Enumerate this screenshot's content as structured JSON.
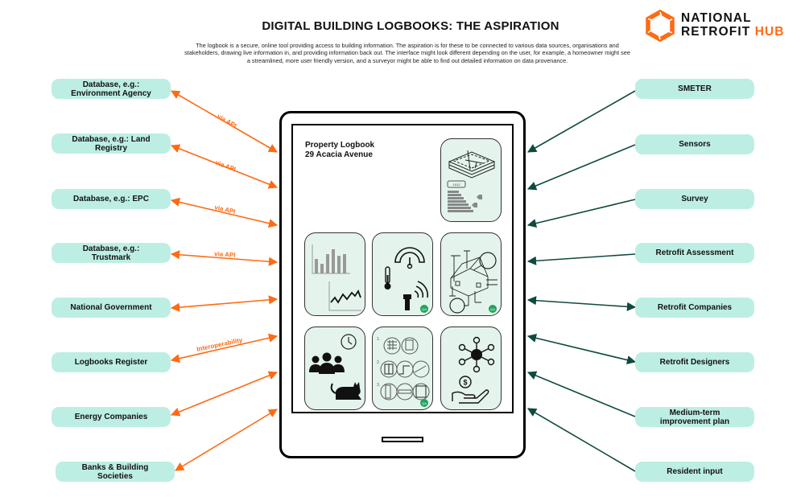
{
  "header": {
    "title": "DIGITAL BUILDING LOGBOOKS: THE ASPIRATION",
    "intro": "The logbook is a secure, online tool providing access to building information. The aspiration is for these to be connected to various data sources, organisations and stakeholders, drawing live information in, and providing information back out. The interface might look different depending on the user, for example, a homeowner might see a streamlined, more user friendly version, and a surveyor might be able to find out detailed information on data provenance."
  },
  "logo": {
    "line1": "NATIONAL",
    "line2a": "RETROFIT",
    "line2b": "HUB",
    "icon": "hexagon-ring-icon"
  },
  "colors": {
    "node_fill": "#bdeee4",
    "left_arrow": "#ff6a13",
    "right_arrow": "#0f4a3f",
    "tile_fill": "#e4f4ec",
    "qa_badge": "#1fa35c"
  },
  "left_nodes": [
    {
      "line1": "Database, e.g.:",
      "line2": "Environment Agency",
      "link_label": "via API",
      "direction": "both"
    },
    {
      "line1": "Database, e.g.: Land",
      "line2": "Registry",
      "link_label": "via API",
      "direction": "both"
    },
    {
      "line1": "Database, e.g.: EPC",
      "line2": "",
      "link_label": "via API",
      "direction": "both"
    },
    {
      "line1": "Database, e.g.:",
      "line2": "Trustmark",
      "link_label": "via API",
      "direction": "both"
    },
    {
      "line1": "National Government",
      "line2": "",
      "link_label": "",
      "direction": "both"
    },
    {
      "line1": "Logbooks Register",
      "line2": "",
      "link_label": "Interoperability",
      "direction": "both"
    },
    {
      "line1": "Energy Companies",
      "line2": "",
      "link_label": "",
      "direction": "both"
    },
    {
      "line1": "Banks & Building",
      "line2": "Societies",
      "link_label": "",
      "direction": "both"
    }
  ],
  "right_nodes": [
    {
      "line1": "SMETER",
      "line2": "",
      "direction": "in"
    },
    {
      "line1": "Sensors",
      "line2": "",
      "direction": "in"
    },
    {
      "line1": "Survey",
      "line2": "",
      "direction": "in"
    },
    {
      "line1": "Retrofit Assessment",
      "line2": "",
      "direction": "in"
    },
    {
      "line1": "Retrofit Companies",
      "line2": "",
      "direction": "both"
    },
    {
      "line1": "Retrofit Designers",
      "line2": "",
      "direction": "both"
    },
    {
      "line1": "Medium-term",
      "line2": "improvement plan",
      "direction": "in"
    },
    {
      "line1": "Resident input",
      "line2": "",
      "direction": "in"
    }
  ],
  "device": {
    "logbook_title": "Property Logbook",
    "address": "29 Acacia Avenue",
    "tiles": [
      {
        "icon": "building-layers-epc-icon",
        "epc_label": "1912"
      },
      {
        "icon": "bar-line-chart-icon"
      },
      {
        "icon": "gauge-thermometer-sensor-icon",
        "badge": "QA"
      },
      {
        "icon": "house-survey-diagram-icon",
        "badge": "QA"
      },
      {
        "icon": "people-clock-pet-icon"
      },
      {
        "icon": "retrofit-measures-steps-icon",
        "badge": "QA",
        "steps": [
          "1.",
          "2.",
          "3."
        ]
      },
      {
        "icon": "network-finance-icon",
        "currency": "$"
      }
    ]
  }
}
